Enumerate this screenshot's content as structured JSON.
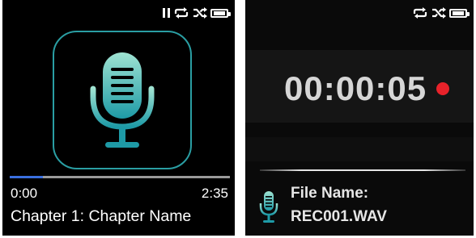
{
  "player": {
    "status_icons": [
      "pause-icon",
      "repeat-icon",
      "shuffle-icon",
      "battery-icon"
    ],
    "battery_level": 0.8,
    "cover_icon": "microphone-icon",
    "colors": {
      "accent": "#2a9ea3",
      "progress_played": "#3a6fe0",
      "progress_track": "#9a9a9a"
    },
    "progress": 0.15,
    "elapsed": "0:00",
    "total": "2:35",
    "track_title": "Chapter 1: Chapter Name"
  },
  "recorder": {
    "status_icons": [
      "repeat-icon",
      "shuffle-icon",
      "battery-icon"
    ],
    "battery_level": 0.8,
    "timer": "00:00:05",
    "recording_indicator_color": "#e8222a",
    "file_icon": "microphone-icon",
    "file_label": "File Name:",
    "file_name": "REC001.WAV"
  }
}
